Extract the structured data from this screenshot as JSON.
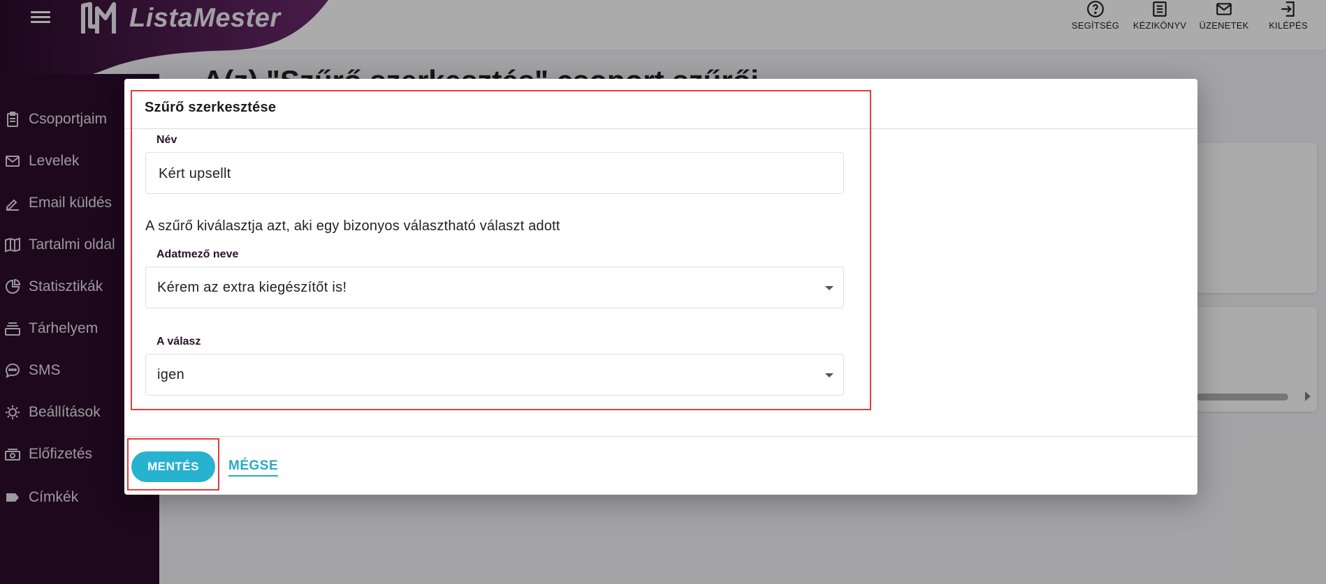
{
  "app": {
    "name": "ListaMester",
    "brand_color": "#3a1138",
    "accent_color": "#27b2cf"
  },
  "header": {
    "menu_icon": "hamburger-icon",
    "actions": [
      {
        "label": "SEGÍTSÉG",
        "icon": "help-circle-icon"
      },
      {
        "label": "KÉZIKÖNYV",
        "icon": "manual-list-icon"
      },
      {
        "label": "ÜZENETEK",
        "icon": "envelope-icon"
      },
      {
        "label": "KILÉPÉS",
        "icon": "logout-icon"
      }
    ]
  },
  "sidebar": {
    "items": [
      {
        "label": "Csoportjaim",
        "icon": "clipboard-icon"
      },
      {
        "label": "Levelek",
        "icon": "envelope-icon"
      },
      {
        "label": "Email küldés",
        "icon": "pencil-icon"
      },
      {
        "label": "Tartalmi oldal",
        "icon": "book-icon"
      },
      {
        "label": "Statisztikák",
        "icon": "pie-chart-icon"
      },
      {
        "label": "Tárhelyem",
        "icon": "archive-icon"
      },
      {
        "label": "SMS",
        "icon": "chat-bubble-icon"
      },
      {
        "label": "Beállítások",
        "icon": "gear-icon"
      },
      {
        "label": "Előfizetés",
        "icon": "cash-icon"
      },
      {
        "label": "Címkék",
        "icon": "tag-icon"
      }
    ]
  },
  "main": {
    "title_partial": "A(z) \"Szűrő szerkesztés\" csoport szűrői"
  },
  "dialog": {
    "title": "Szűrő szerkesztése",
    "name_label": "Név",
    "name_value": "Kért upsellt",
    "description": "A szűrő kiválasztja azt, aki egy bizonyos választható választ adott",
    "field_label": "Adatmező neve",
    "field_value": "Kérem az extra kiegészítőt is!",
    "answer_label": "A válasz",
    "answer_value": "igen",
    "save_label": "MENTÉS",
    "cancel_label": "MÉGSE"
  }
}
